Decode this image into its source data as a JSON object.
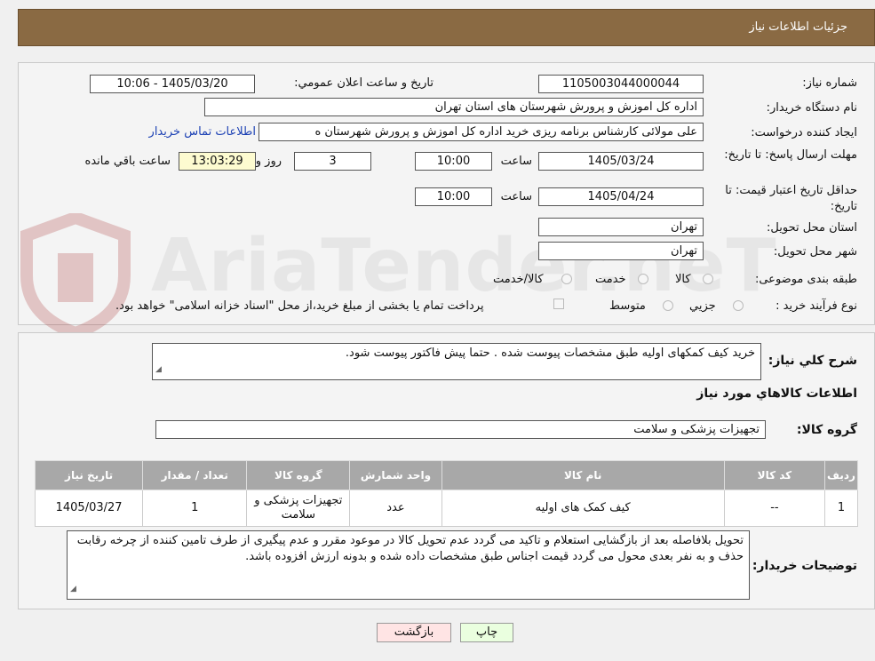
{
  "header": {
    "title": "جزئیات اطلاعات نیاز"
  },
  "watermark": "AriaTender.neT",
  "form": {
    "need_number": {
      "label": "شماره نیاز:",
      "value": "1105003044000044"
    },
    "announce": {
      "label": "تاریخ و ساعت اعلان عمومي:",
      "value": "1405/03/20 - 10:06"
    },
    "buyer_org": {
      "label": "نام دستگاه خريدار:",
      "value": "اداره کل اموزش و پرورش شهرستان های استان تهران"
    },
    "creator": {
      "label": "ايجاد کننده درخواست:",
      "value": "علی مولائی کارشناس برنامه ریزی خرید  اداره کل اموزش و پرورش شهرستان ه",
      "contact_link": "اطلاعات تماس خريدار"
    },
    "reply_deadline": {
      "label": "مهلت ارسال پاسخ: تا تاریخ:",
      "date": "1405/03/24",
      "time_label": "ساعت",
      "time": "10:00",
      "days": "3",
      "days_label": "روز و",
      "remaining": "13:03:29",
      "remaining_label": "ساعت باقي مانده"
    },
    "price_validity": {
      "label": "حداقل تاريخ اعتبار قيمت: تا تاريخ:",
      "date": "1405/04/24",
      "time_label": "ساعت",
      "time": "10:00"
    },
    "province": {
      "label": "استان محل تحويل:",
      "value": "تهران"
    },
    "city": {
      "label": "شهر محل تحويل:",
      "value": "تهران"
    },
    "category": {
      "label": "طبقه بندی موضوعی:",
      "options": [
        "کالا",
        "خدمت",
        "کالا/خدمت"
      ]
    },
    "process": {
      "label": "نوع فرآيند خريد :",
      "options": [
        "جزيي",
        "متوسط"
      ],
      "note": "پرداخت تمام يا بخشی از مبلغ خريد،از محل \"اسناد خزانه اسلامی\" خواهد بود."
    }
  },
  "description": {
    "label": "شرح کلي نياز:",
    "value": "خرید کیف کمکهای اولیه طبق مشخصات پیوست شده . حتما پیش فاکتور پیوست شود."
  },
  "goods_section": {
    "title": "اطلاعات کالاهاي مورد نياز"
  },
  "goods_group": {
    "label": "گروه کالا:",
    "value": "تجهیزات پزشکی و سلامت"
  },
  "table": {
    "headers": [
      "رديف",
      "کد کالا",
      "نام کالا",
      "واحد شمارش",
      "گروه کالا",
      "تعداد / مقدار",
      "تاريخ نياز"
    ],
    "rows": [
      [
        "1",
        "--",
        "کیف کمک های اولیه",
        "عدد",
        "تجهیزات پزشکی و سلامت",
        "1",
        "1405/03/27"
      ]
    ]
  },
  "buyer_notes": {
    "label": "توضيحات خريدار:",
    "value": "تحویل بلافاصله بعد از بازگشایی استعلام و تاکید می گردد عدم تحویل کالا در موعود مقرر و عدم پیگیری از طرف تامین کننده از چرخه رقابت حذف و به نفر بعدی محول می گردد قیمت اجناس طبق مشخصات داده شده و بدونه ارزش افزوده باشد."
  },
  "buttons": {
    "print": "چاپ",
    "back": "بازگشت"
  },
  "colors": {
    "header_bg": "#8a6a43",
    "link": "#1a3fb3",
    "time_bg": "#fdfbd0",
    "print_bg": "#eaffdf",
    "back_bg": "#ffe4e4",
    "table_header": "#a8a8a8"
  }
}
